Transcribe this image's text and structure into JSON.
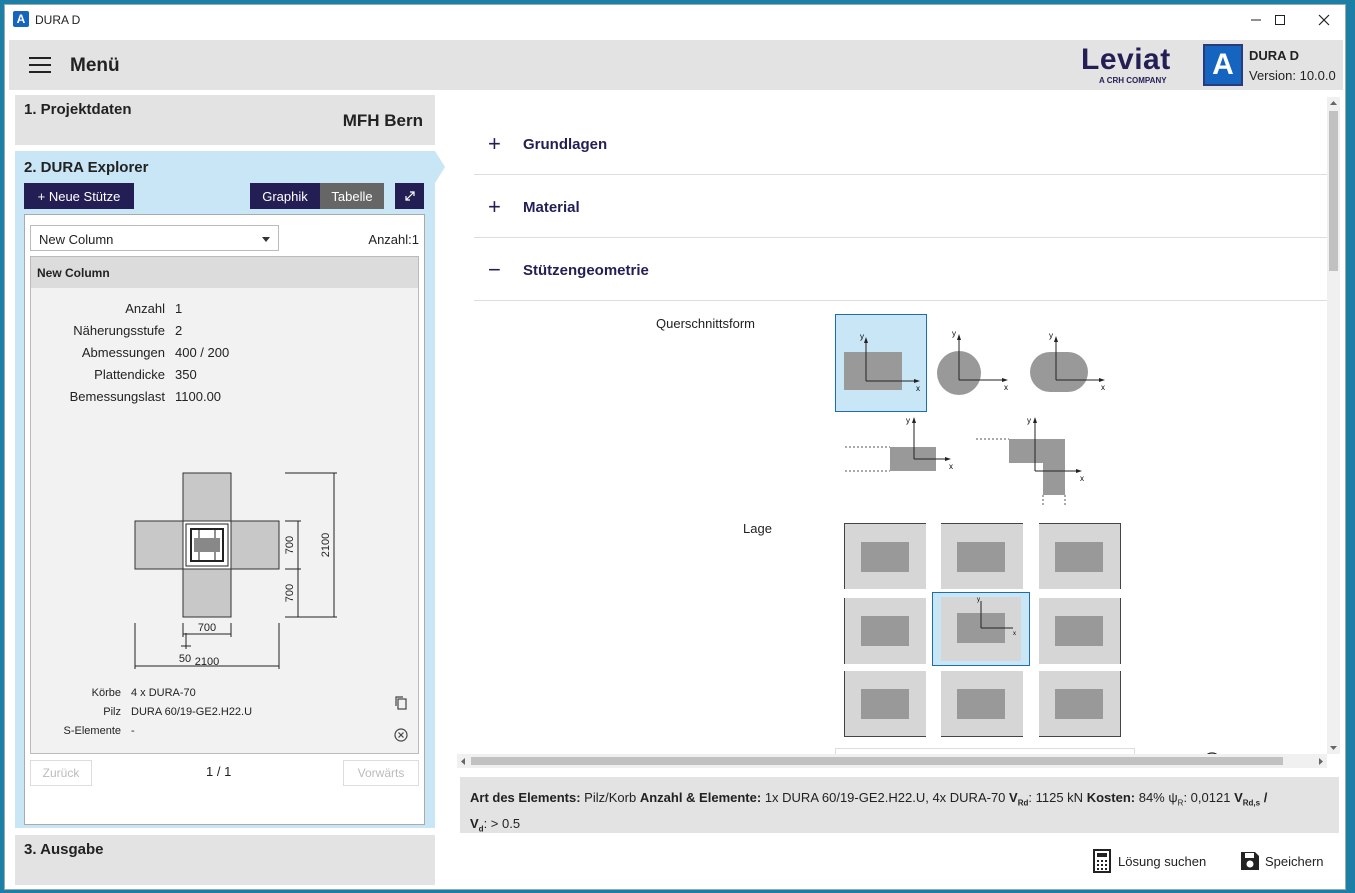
{
  "window": {
    "title": "DURA D"
  },
  "menubar": {
    "menu_label": "Menü",
    "brand_word": "Leviat",
    "brand_sub": "A CRH COMPANY",
    "app_logo_letter": "A",
    "app_name": "DURA D",
    "app_version": "Version: 10.0.0"
  },
  "sections": {
    "s1": {
      "title": "1. Projektdaten",
      "value": "MFH Bern"
    },
    "s2": {
      "title": "2. DURA Explorer"
    },
    "s3": {
      "title": "3. Ausgabe"
    }
  },
  "explorer": {
    "new_button": "+ Neue Stütze",
    "view_graphik": "Graphik",
    "view_tabelle": "Tabelle",
    "dropdown_value": "New Column",
    "count_label": "Anzahl:1",
    "card_title": "New Column",
    "props": [
      {
        "k": "Anzahl",
        "v": "1"
      },
      {
        "k": "Näherungsstufe",
        "v": "2"
      },
      {
        "k": "Abmessungen",
        "v": "400 / 200"
      },
      {
        "k": "Plattendicke",
        "v": "350"
      },
      {
        "k": "Bemessungslast",
        "v": "1100.00"
      }
    ],
    "drawing": {
      "dim_700_v1": "700",
      "dim_2100_v": "2100",
      "dim_700_v2": "700",
      "dim_700_h": "700",
      "dim_50": "50",
      "dim_2100_h": "2100"
    },
    "details": [
      {
        "k": "Körbe",
        "v": "4 x DURA-70"
      },
      {
        "k": "Pilz",
        "v": "DURA 60/19-GE2.H22.U"
      },
      {
        "k": "S-Elemente",
        "v": "-"
      }
    ],
    "pager": {
      "prev": "Zurück",
      "page": "1 / 1",
      "next": "Vorwärts"
    }
  },
  "accordion": [
    {
      "sign": "+",
      "label": "Grundlagen"
    },
    {
      "sign": "+",
      "label": "Material"
    },
    {
      "sign": "−",
      "label": "Stützengeometrie"
    }
  ],
  "geometry": {
    "querschnitt_label": "Querschnittsform",
    "lage_label": "Lage",
    "axis_x": "x",
    "axis_y": "y"
  },
  "status": {
    "k1": "Art des Elements:",
    "v1": "Pilz/Korb",
    "k2": "Anzahl & Elemente:",
    "v2": "1x DURA 60/19-GE2.H22.U, 4x DURA-70",
    "k3": "V",
    "k3sub": "Rd",
    "v3": ": 1125 kN",
    "k4": "Kosten:",
    "v4": "84%",
    "k5": "ψ",
    "k5sub": "R",
    "v5": ": 0,0121",
    "k6": "V",
    "k6sub": "Rd,s",
    "k6b": "/",
    "k7": "V",
    "k7sub": "d",
    "v7": ": > 0.5"
  },
  "footer": {
    "solve": "Lösung suchen",
    "save": "Speichern"
  },
  "colors": {
    "accent": "#231f55",
    "selected": "#c8e6f5",
    "shape": "#999999"
  }
}
